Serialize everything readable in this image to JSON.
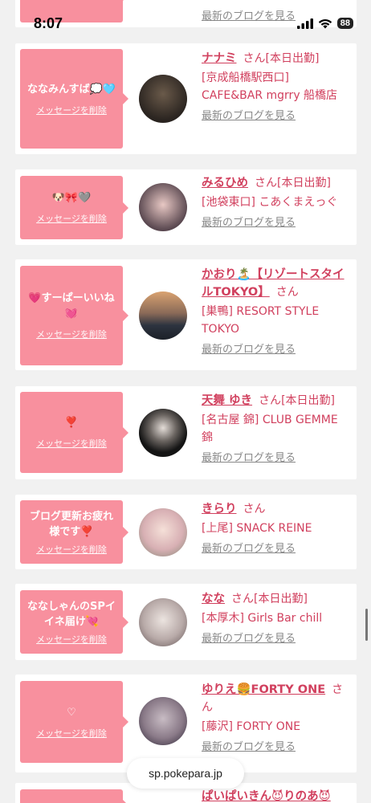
{
  "status": {
    "time": "8:07",
    "battery": "88"
  },
  "browser": {
    "url": "sp.pokepara.jp"
  },
  "delete_label": "メッセージを削除",
  "blog_label": "最新のブログを見る",
  "san_label": "さん",
  "top_partial": {
    "blog": "最新のブログを見る"
  },
  "cards": [
    {
      "message": "ななみんすば💭🩵",
      "name": "ナナミ",
      "status": "[本日出勤]",
      "shop": "[京成船橋駅西口] CAFE&BAR mgrry 船橋店"
    },
    {
      "message": "🐶🎀🩶",
      "name": "みるひめ",
      "status": "[本日出勤]",
      "shop": "[池袋東口] こあくまえっぐ"
    },
    {
      "message": "💗すーぱーいいね💓",
      "name": "かおり🏝️【リゾートスタイルTOKYO】",
      "status": "",
      "shop": "[巣鴨] RESORT STYLE TOKYO"
    },
    {
      "message": "❣️",
      "name": "天舞 ゆき",
      "status": "[本日出勤]",
      "shop": "[名古屋 錦] CLUB GEMME 錦"
    },
    {
      "message": "ブログ更新お疲れ様です❣️",
      "name": "きらり",
      "status": "",
      "shop": "[上尾] SNACK REINE"
    },
    {
      "message": "ななしゃんのSPイイネ届け💘",
      "name": "なな",
      "status": "[本日出勤]",
      "shop": "[本厚木] Girls Bar chill"
    },
    {
      "message": "♡",
      "name": "ゆりえ🍔FORTY ONE",
      "status": "",
      "shop": "[藤沢] FORTY ONE"
    },
    {
      "message": "",
      "name": "ぱいぱいきん😈りのあ😈",
      "status": "",
      "shop": ""
    }
  ]
}
